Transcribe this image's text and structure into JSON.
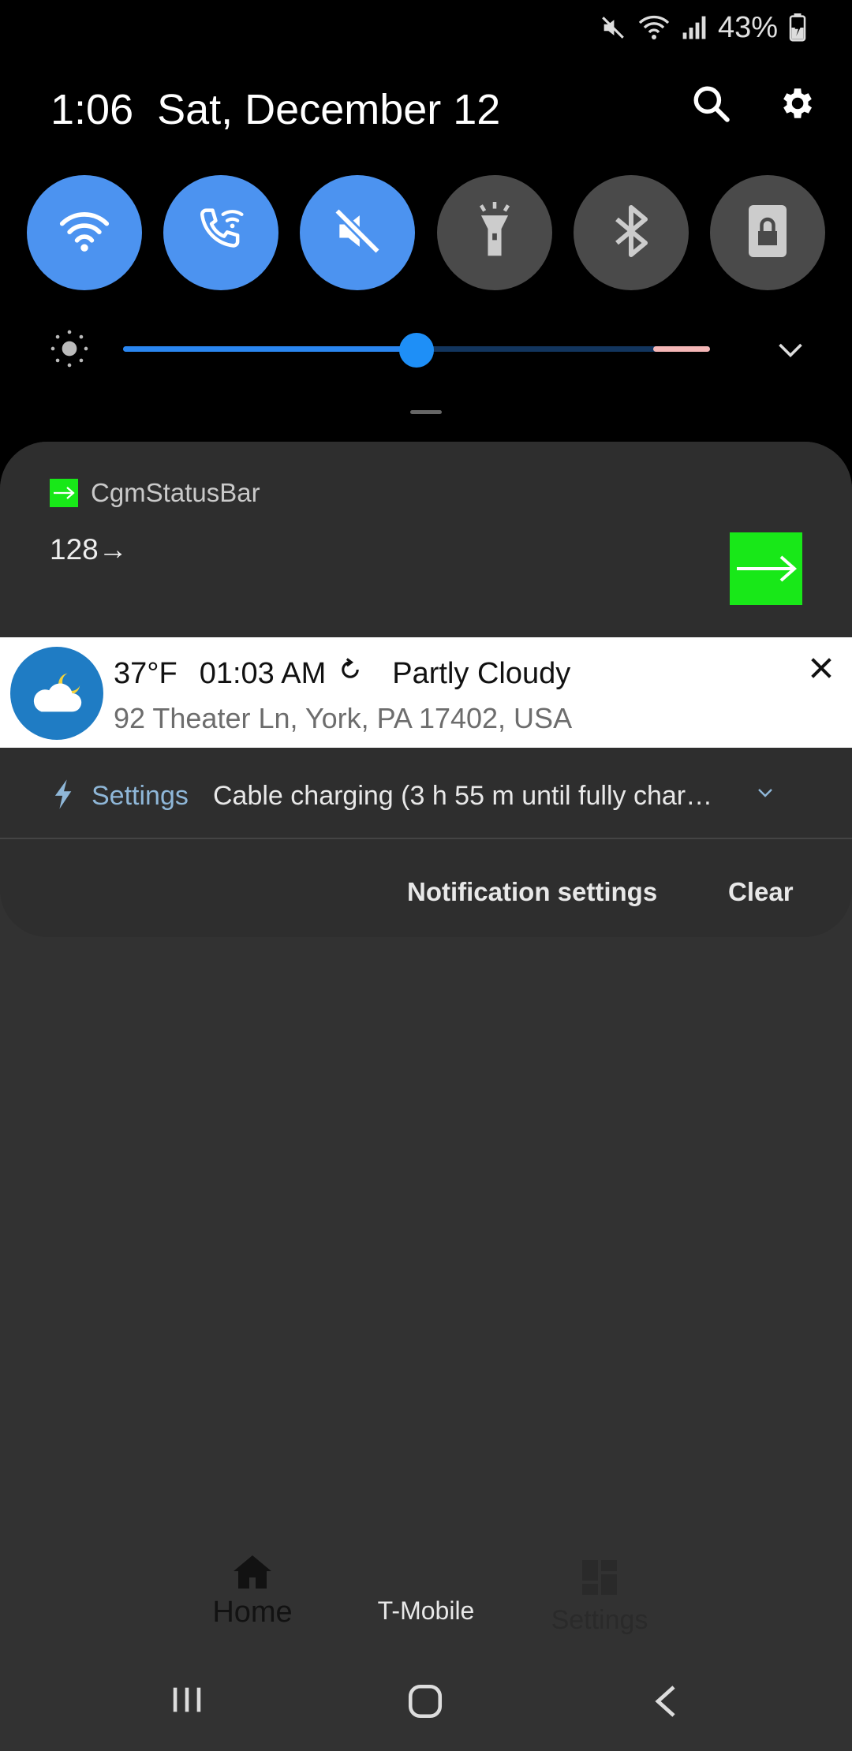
{
  "status_bar": {
    "battery_percent": "43%"
  },
  "header": {
    "time": "1:06",
    "date": "Sat, December 12"
  },
  "quick_settings": [
    {
      "name": "Wi-Fi",
      "icon": "wifi-icon",
      "state": "on"
    },
    {
      "name": "Wi-Fi Calling",
      "icon": "wifi-calling-icon",
      "state": "on"
    },
    {
      "name": "Mute",
      "icon": "mute-icon",
      "state": "on"
    },
    {
      "name": "Flashlight",
      "icon": "flashlight-icon",
      "state": "off"
    },
    {
      "name": "Bluetooth",
      "icon": "bluetooth-icon",
      "state": "off"
    },
    {
      "name": "Screen lock",
      "icon": "lock-icon",
      "state": "off"
    }
  ],
  "brightness": {
    "level": 0.5
  },
  "notifications": {
    "cgm": {
      "app_name": "CgmStatusBar",
      "value": "128→",
      "icon": "arrow-right-icon"
    },
    "weather": {
      "temperature": "37°F",
      "time": "01:03 AM",
      "condition": "Partly Cloudy",
      "address": "92 Theater Ln, York, PA 17402, USA",
      "icon": "partly-cloudy-night-icon"
    },
    "charging": {
      "app_name": "Settings",
      "text": "Cable charging (3 h 55 m until fully char…"
    }
  },
  "actions": {
    "notification_settings": "Notification settings",
    "clear": "Clear"
  },
  "dock": {
    "home_label": "Home",
    "carrier": "T-Mobile",
    "settings_label": "Settings"
  },
  "colors": {
    "accent": "#4c93f0",
    "tile_off": "#4a4a4a",
    "cgm_green": "#18e818",
    "weather_blue": "#1f7cc4"
  }
}
